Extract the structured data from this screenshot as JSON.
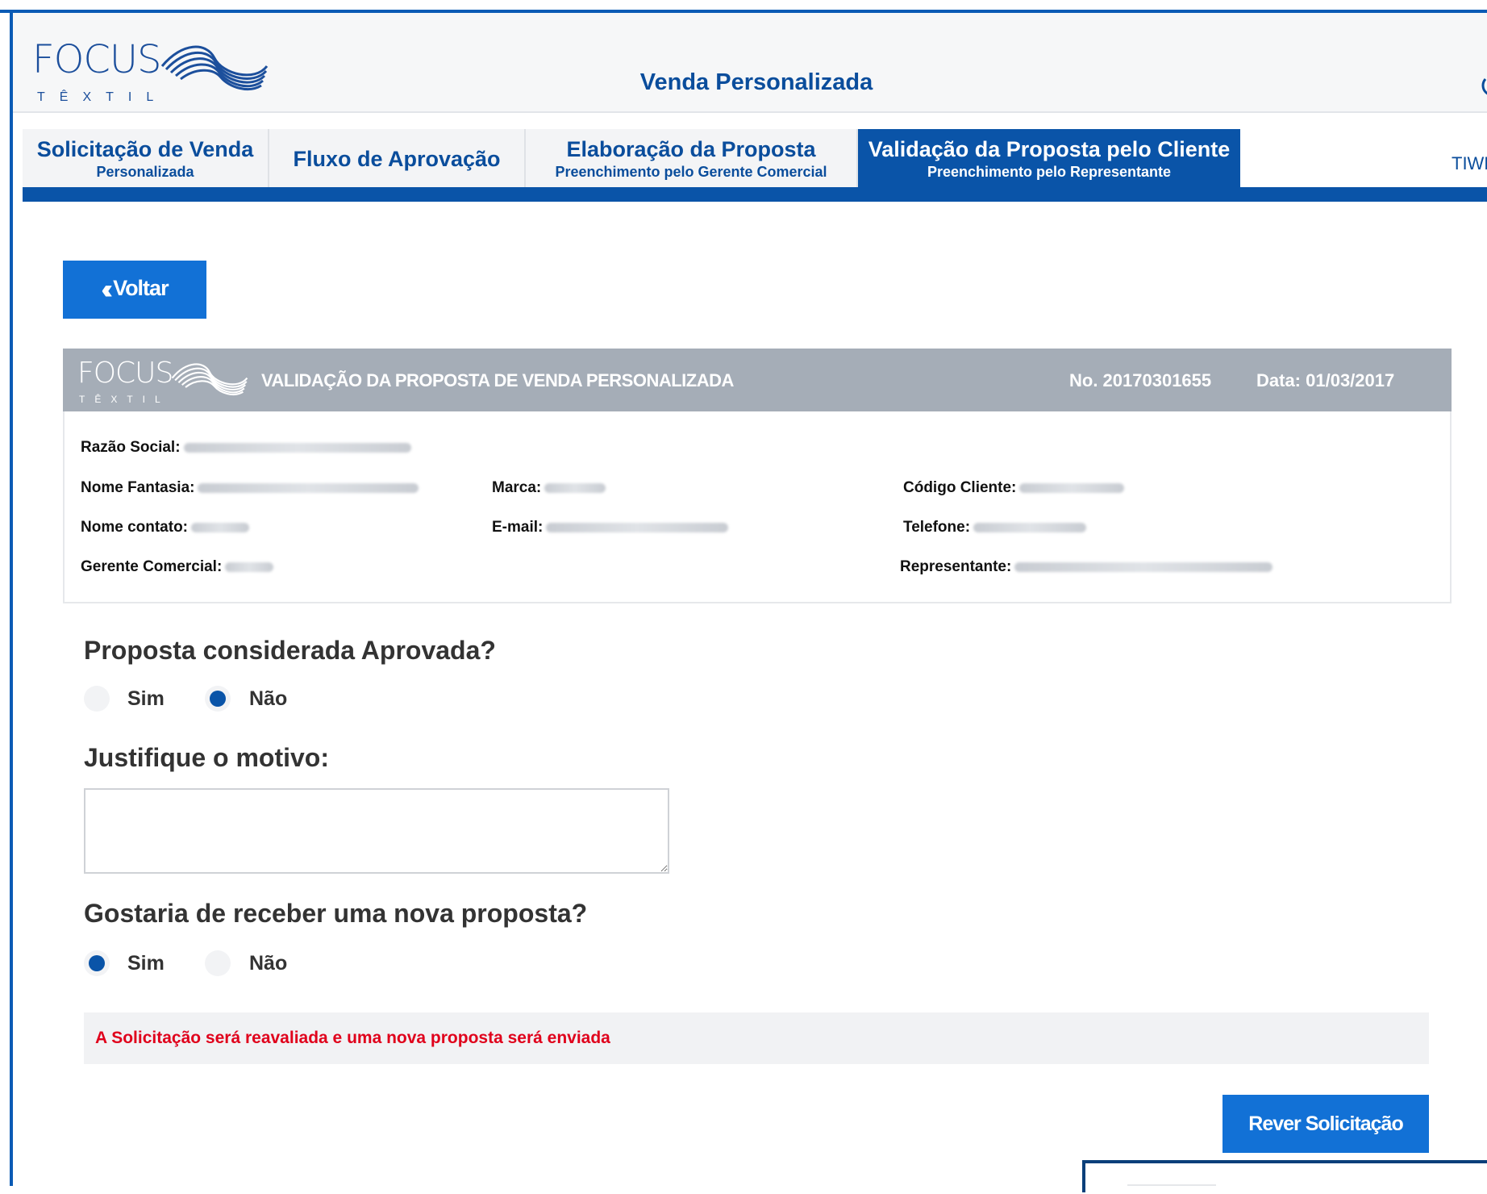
{
  "header": {
    "brand": "FOCUS",
    "brand_sub": "TÊXTIL",
    "title": "Venda Personalizada"
  },
  "tabs": [
    {
      "title": "Solicitação de Venda",
      "subtitle": "Personalizada"
    },
    {
      "title": "Fluxo de Aprovação",
      "subtitle": ""
    },
    {
      "title": "Elaboração da Proposta",
      "subtitle": "Preenchimento pelo Gerente Comercial"
    },
    {
      "title": "Validação da Proposta pelo Cliente",
      "subtitle": "Preenchimento pelo Representante",
      "active": true
    }
  ],
  "user_label": "TIWEB",
  "back_button": {
    "label": "Voltar"
  },
  "document": {
    "brand": "FOCUS",
    "brand_sub": "TÊXTIL",
    "title": "VALIDAÇÃO DA PROPOSTA DE VENDA PERSONALIZADA",
    "number": "No. 20170301655",
    "date": "Data: 01/03/2017",
    "fields": {
      "razao_social": "Razão Social:",
      "nome_fantasia": "Nome Fantasia:",
      "marca": "Marca:",
      "codigo_cliente": "Código Cliente:",
      "nome_contato": "Nome contato:",
      "email": "E-mail:",
      "telefone": "Telefone:",
      "gerente_comercial": "Gerente Comercial:",
      "representante": "Representante:"
    }
  },
  "form": {
    "q1": "Proposta considerada Aprovada?",
    "q1_options": {
      "sim": "Sim",
      "nao": "Não"
    },
    "q1_selected": "nao",
    "q2": "Justifique o motivo:",
    "justification_value": "",
    "q3": "Gostaria de receber uma nova proposta?",
    "q3_options": {
      "sim": "Sim",
      "nao": "Não"
    },
    "q3_selected": "sim",
    "notice": "A Solicitação será reavaliada e uma nova proposta será enviada",
    "submit_label": "Rever Solicitação"
  },
  "colors": {
    "primary": "#0a54a8",
    "button": "#1271d6",
    "doc_header": "#a5adb7",
    "notice_text": "#e0001b"
  }
}
